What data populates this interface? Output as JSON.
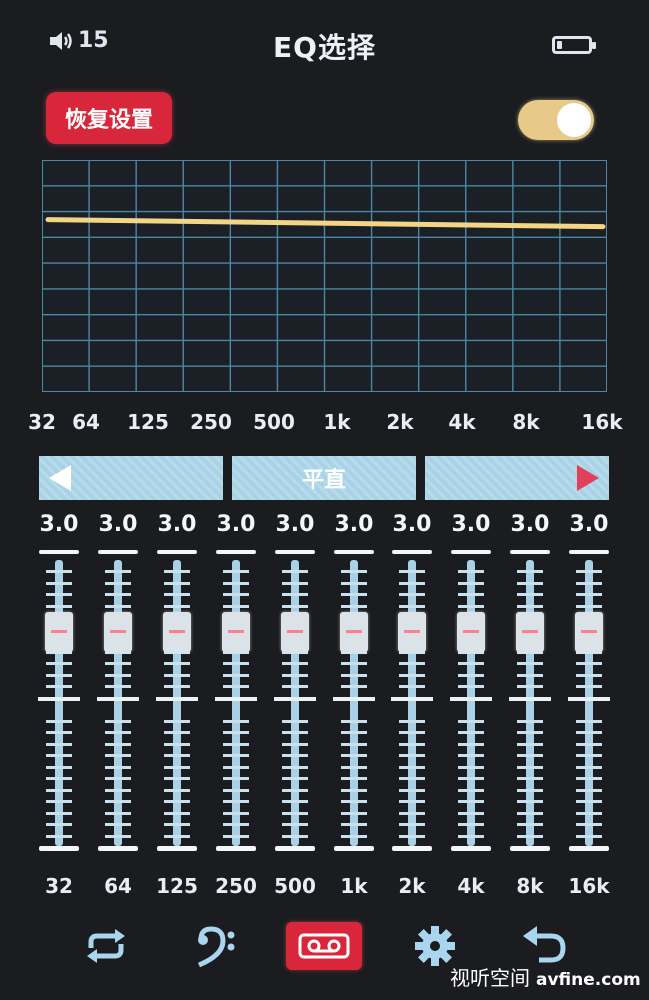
{
  "status": {
    "volume": "15",
    "title": "EQ选择",
    "battery_level_fraction": 0.15
  },
  "controls": {
    "reset_label": "恢复设置",
    "toggle_on": true
  },
  "graph": {
    "columns": 12,
    "rows": 9,
    "curve_color": "#f3d586",
    "curve_level_row_fraction": 0.27
  },
  "frequency_labels": [
    "32",
    "64",
    "125",
    "250",
    "500",
    "1k",
    "2k",
    "4k",
    "8k",
    "16k"
  ],
  "preset": {
    "prev_icon": "triangle-left",
    "name": "平直",
    "next_icon": "triangle-right"
  },
  "bands": [
    {
      "freq": "32",
      "value": "3.0"
    },
    {
      "freq": "64",
      "value": "3.0"
    },
    {
      "freq": "125",
      "value": "3.0"
    },
    {
      "freq": "250",
      "value": "3.0"
    },
    {
      "freq": "500",
      "value": "3.0"
    },
    {
      "freq": "1k",
      "value": "3.0"
    },
    {
      "freq": "2k",
      "value": "3.0"
    },
    {
      "freq": "4k",
      "value": "3.0"
    },
    {
      "freq": "8k",
      "value": "3.0"
    },
    {
      "freq": "16k",
      "value": "3.0"
    }
  ],
  "bottom_nav": [
    "repeat-icon",
    "bass-clef-icon",
    "cassette-tape-icon",
    "gear-icon",
    "return-icon"
  ],
  "colors": {
    "accent_red": "#d8273a",
    "panel_blue": "#a8d2e6",
    "grid_line": "#4c87a3",
    "background": "#1b1c20"
  },
  "watermark": {
    "cn": "视听空间",
    "site": "avfine.com"
  }
}
